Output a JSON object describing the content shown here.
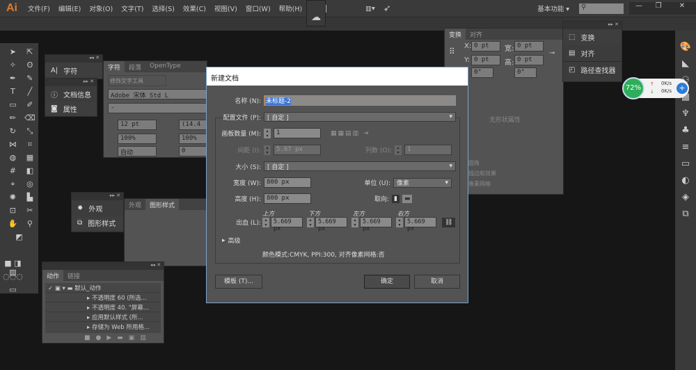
{
  "app": {
    "logo": "Ai",
    "menus": [
      "文件(F)",
      "编辑(E)",
      "对象(O)",
      "文字(T)",
      "选择(S)",
      "效果(C)",
      "视图(V)",
      "窗口(W)",
      "帮助(H)"
    ],
    "bridge": "Br",
    "workspace": "基本功能",
    "window_buttons": [
      "minimize",
      "restore",
      "close"
    ]
  },
  "panels": {
    "char_dock": {
      "items": [
        "字符"
      ]
    },
    "doc_dock": {
      "items": [
        "文档信息",
        "属性"
      ]
    },
    "character": {
      "tabs": [
        "字符",
        "段落",
        "OpenType"
      ],
      "touch_tool": "修饰文字工具",
      "font": "Adobe 宋体 Std L",
      "style": "-",
      "size": "12 pt",
      "leading": "(14.4",
      "hscale": "100%",
      "vscale": "100%",
      "kerning": "自动",
      "tracking": "0"
    },
    "appearance_dock": {
      "items": [
        "外观",
        "图形样式"
      ]
    },
    "appearance": {
      "tabs": [
        "外观",
        "图形样式"
      ]
    },
    "actions": {
      "tabs": [
        "动作",
        "链接"
      ],
      "rows": [
        "默认_动作",
        "不透明度 60 (所选...",
        "不透明度 40. \"屏幕...",
        "应用默认样式 (所...",
        "存储为 Web 所用格..."
      ]
    },
    "transform": {
      "tabs": [
        "变换",
        "对齐"
      ],
      "x": "0 pt",
      "y": "0 pt",
      "w": "0 pt",
      "h": "0 pt",
      "rotate": "0°",
      "shear": "0°",
      "x_label": "X:",
      "y_label": "Y:",
      "w_label": "宽:",
      "h_label": "高:",
      "empty": "无形状属性",
      "extra": [
        "圆角",
        "描边和效果",
        "像素网格"
      ]
    },
    "transform_dock": {
      "items": [
        "变换",
        "对齐",
        "路径查找器"
      ]
    }
  },
  "netmon": {
    "percent": "72%",
    "up": "0K/s",
    "down": "0K/s"
  },
  "dialog": {
    "title": "新建文档",
    "name_label": "名称 (N):",
    "name_value": "未标题-2",
    "profile_label": "配置文件 (P):",
    "profile_value": "[ 自定 ]",
    "artboards_label": "画板数量 (M):",
    "artboards_value": "1",
    "spacing_label": "间距 (I):",
    "spacing_value": "5.67 px",
    "columns_label": "列数 (O):",
    "columns_value": "1",
    "size_label": "大小 (S):",
    "size_value": "[ 自定 ]",
    "width_label": "宽度 (W):",
    "width_value": "800 px",
    "units_label": "单位 (U):",
    "units_value": "像素",
    "height_label": "高度 (H):",
    "height_value": "800 px",
    "orientation_label": "取向:",
    "bleed_label": "出血 (L):",
    "bleed": [
      {
        "label": "上方",
        "value": "5.669 px"
      },
      {
        "label": "下方",
        "value": "5.669 px"
      },
      {
        "label": "左方",
        "value": "5.669 px"
      },
      {
        "label": "右方",
        "value": "5.669 px"
      }
    ],
    "advanced": "高级",
    "summary": "颜色模式:CMYK, PPI:300, 对齐像素网格:否",
    "templates_btn": "模板 (T)...",
    "ok_btn": "确定",
    "cancel_btn": "取消"
  }
}
